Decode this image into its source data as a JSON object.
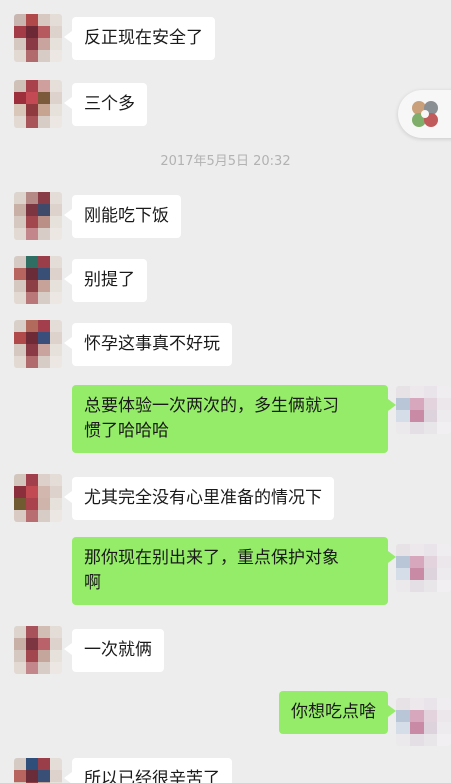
{
  "timestamp": "2017年5月5日 20:32",
  "messages": [
    {
      "side": "left",
      "text": "反正现在安全了"
    },
    {
      "side": "left",
      "text": "三个多"
    },
    {
      "side": "left",
      "text": "刚能吃下饭"
    },
    {
      "side": "left",
      "text": "别提了"
    },
    {
      "side": "left",
      "text": "怀孕这事真不好玩"
    },
    {
      "side": "right",
      "line1": "总要体验一次两次的，多生俩就习",
      "line2": "惯了哈哈哈"
    },
    {
      "side": "left",
      "text": "尤其完全没有心里准备的情况下"
    },
    {
      "side": "right",
      "line1": "那你现在别出来了，重点保护对象",
      "line2": "啊"
    },
    {
      "side": "left",
      "text": "一次就俩"
    },
    {
      "side": "right",
      "text": "你想吃点啥"
    },
    {
      "side": "left",
      "text": "所以已经很辛苦了"
    }
  ],
  "icons": {
    "float": "floating-window-icon",
    "avatar": "pixelated-avatar"
  },
  "colors": {
    "background": "#ededed",
    "sent_bubble": "#95ec69",
    "received_bubble": "#ffffff",
    "timestamp": "#b2b2b2"
  }
}
